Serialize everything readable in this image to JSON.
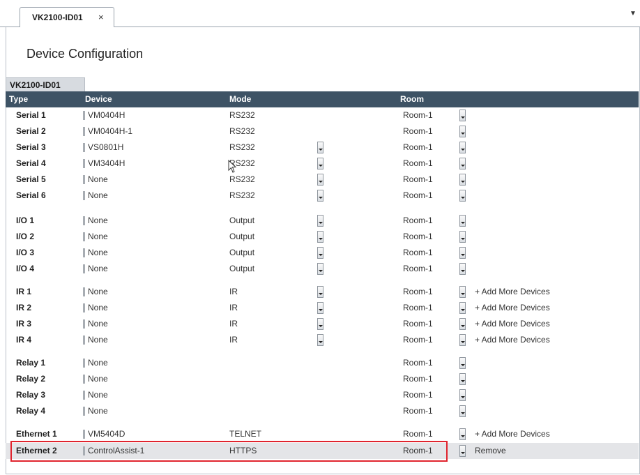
{
  "tab": {
    "label": "VK2100-ID01",
    "close": "×"
  },
  "page_title": "Device Configuration",
  "device_tab": "VK2100-ID01",
  "columns": {
    "type": "Type",
    "device": "Device",
    "mode": "Mode",
    "room": "Room"
  },
  "rows": [
    {
      "type": "Serial 1",
      "device": "VM0404H",
      "mode": "RS232",
      "room": "Room-1",
      "mode_dd": false,
      "action": ""
    },
    {
      "type": "Serial 2",
      "device": "VM0404H-1",
      "mode": "RS232",
      "room": "Room-1",
      "mode_dd": false,
      "action": ""
    },
    {
      "type": "Serial 3",
      "device": "VS0801H",
      "mode": "RS232",
      "room": "Room-1",
      "mode_dd": true,
      "action": ""
    },
    {
      "type": "Serial 4",
      "device": "VM3404H",
      "mode": "RS232",
      "room": "Room-1",
      "mode_dd": true,
      "action": ""
    },
    {
      "type": "Serial 5",
      "device": "None",
      "mode": "RS232",
      "room": "Room-1",
      "mode_dd": true,
      "action": ""
    },
    {
      "type": "Serial 6",
      "device": "None",
      "mode": "RS232",
      "room": "Room-1",
      "mode_dd": true,
      "action": ""
    },
    {
      "type": "I/O 1",
      "device": "None",
      "mode": "Output",
      "room": "Room-1",
      "mode_dd": true,
      "action": ""
    },
    {
      "type": "I/O 2",
      "device": "None",
      "mode": "Output",
      "room": "Room-1",
      "mode_dd": true,
      "action": ""
    },
    {
      "type": "I/O 3",
      "device": "None",
      "mode": "Output",
      "room": "Room-1",
      "mode_dd": true,
      "action": ""
    },
    {
      "type": "I/O 4",
      "device": "None",
      "mode": "Output",
      "room": "Room-1",
      "mode_dd": true,
      "action": ""
    },
    {
      "type": "IR 1",
      "device": "None",
      "mode": "IR",
      "room": "Room-1",
      "mode_dd": true,
      "action": "+ Add More Devices"
    },
    {
      "type": "IR 2",
      "device": "None",
      "mode": "IR",
      "room": "Room-1",
      "mode_dd": true,
      "action": "+ Add More Devices"
    },
    {
      "type": "IR 3",
      "device": "None",
      "mode": "IR",
      "room": "Room-1",
      "mode_dd": true,
      "action": "+ Add More Devices"
    },
    {
      "type": "IR 4",
      "device": "None",
      "mode": "IR",
      "room": "Room-1",
      "mode_dd": true,
      "action": "+ Add More Devices"
    },
    {
      "type": "Relay 1",
      "device": "None",
      "mode": "",
      "room": "Room-1",
      "mode_dd": false,
      "action": ""
    },
    {
      "type": "Relay 2",
      "device": "None",
      "mode": "",
      "room": "Room-1",
      "mode_dd": false,
      "action": ""
    },
    {
      "type": "Relay 3",
      "device": "None",
      "mode": "",
      "room": "Room-1",
      "mode_dd": false,
      "action": ""
    },
    {
      "type": "Relay 4",
      "device": "None",
      "mode": "",
      "room": "Room-1",
      "mode_dd": false,
      "action": ""
    },
    {
      "type": "Ethernet 1",
      "device": "VM5404D",
      "mode": "TELNET",
      "room": "Room-1",
      "mode_dd": false,
      "action": "+ Add More Devices"
    },
    {
      "type": "Ethernet 2",
      "device": "ControlAssist-1",
      "mode": "HTTPS",
      "room": "Room-1",
      "mode_dd": false,
      "action": "Remove",
      "selected": true
    }
  ],
  "colors": {
    "header_bg": "#3e5365",
    "highlight": "#e0242e",
    "selected_row": "#e4e5e8"
  }
}
